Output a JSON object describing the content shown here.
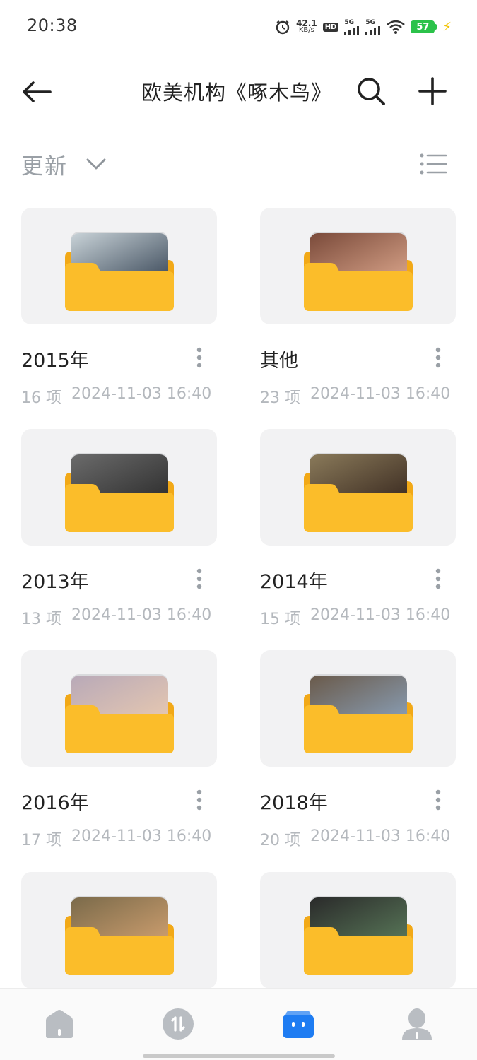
{
  "status_bar": {
    "time": "20:38",
    "net_speed_value": "42.1",
    "net_speed_unit": "KB/s",
    "hd_label": "HD",
    "sim1_label": "5G",
    "sim2_label": "5G",
    "battery_level": "57"
  },
  "header": {
    "title": "欧美机构《啄木鸟》",
    "back_icon": "back-arrow-icon",
    "search_icon": "search-icon",
    "add_icon": "plus-icon"
  },
  "sort": {
    "label": "更新",
    "chevron_icon": "chevron-down-icon",
    "view_icon": "list-view-icon"
  },
  "folders": [
    {
      "name": "2015年",
      "count": "16 项",
      "date": "2024-11-03 16:40",
      "preview_colors": [
        "#c9d3d8",
        "#3c4a5a"
      ]
    },
    {
      "name": "其他",
      "count": "23 项",
      "date": "2024-11-03 16:40",
      "preview_colors": [
        "#7a4a3a",
        "#d9a48a"
      ]
    },
    {
      "name": "2013年",
      "count": "13 项",
      "date": "2024-11-03 16:40",
      "preview_colors": [
        "#6b6b6b",
        "#2d2d2d"
      ]
    },
    {
      "name": "2014年",
      "count": "15 项",
      "date": "2024-11-03 16:40",
      "preview_colors": [
        "#8a7a5a",
        "#3a2a20"
      ]
    },
    {
      "name": "2016年",
      "count": "17 项",
      "date": "2024-11-03 16:40",
      "preview_colors": [
        "#b8a9b8",
        "#e8c9b0"
      ]
    },
    {
      "name": "2018年",
      "count": "20 项",
      "date": "2024-11-03 16:40",
      "preview_colors": [
        "#6a5a4a",
        "#8aa0b8"
      ]
    },
    {
      "name": "",
      "count": "",
      "date": "",
      "preview_colors": [
        "#7a6a4a",
        "#d0a070"
      ]
    },
    {
      "name": "",
      "count": "",
      "date": "",
      "preview_colors": [
        "#2a2a2a",
        "#5a7a5a"
      ]
    }
  ],
  "colors": {
    "folder_yellow": "#fbbd2a",
    "folder_back": "#f2a917",
    "accent_blue": "#1e7cf2",
    "nav_gray": "#b9bdc2"
  },
  "bottom_nav": [
    {
      "icon": "home-icon",
      "active": false
    },
    {
      "icon": "transfer-icon",
      "active": false
    },
    {
      "icon": "files-icon",
      "active": true
    },
    {
      "icon": "profile-icon",
      "active": false
    }
  ]
}
